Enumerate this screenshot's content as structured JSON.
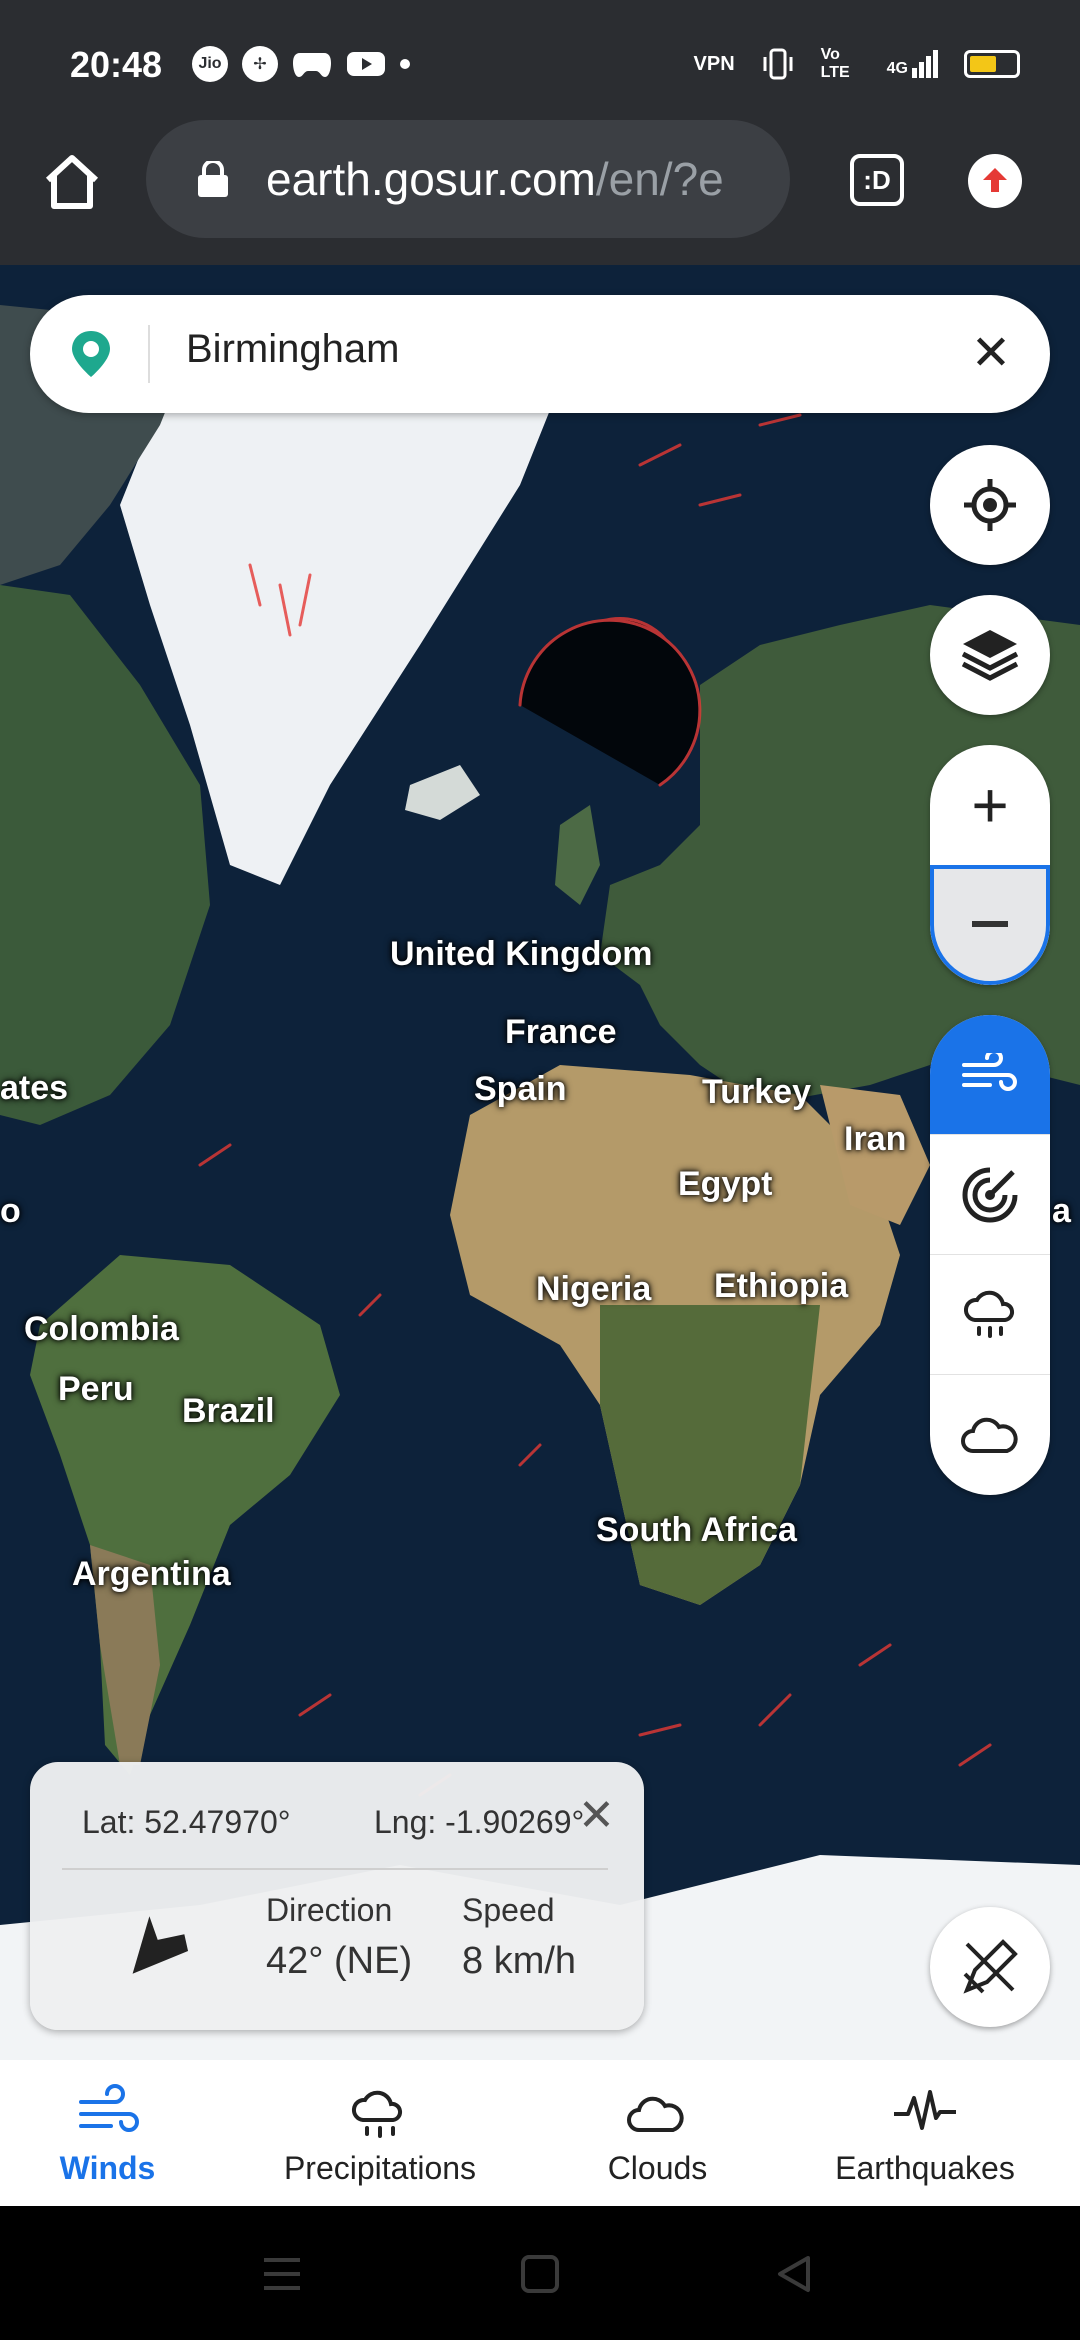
{
  "status_bar": {
    "time": "20:48",
    "left_icons": [
      "jio-icon",
      "pinwheel-icon",
      "gamepad-icon",
      "youtube-icon"
    ],
    "vpn_label": "VPN",
    "volte_label": "Vo LTE",
    "network_label": "4G",
    "battery_color": "#f3c617"
  },
  "browser": {
    "url_host": "earth.gosur.com",
    "url_path": "/en/?e",
    "tab_label": ":D"
  },
  "search": {
    "query": "Birmingham",
    "clear_label": "✕"
  },
  "map": {
    "country_labels": {
      "uk": "United Kingdom",
      "france": "France",
      "spain": "Spain",
      "turkey": "Turkey",
      "iran": "Iran",
      "egypt": "Egypt",
      "nigeria": "Nigeria",
      "ethiopia": "Ethiopia",
      "colombia": "Colombia",
      "peru": "Peru",
      "brazil": "Brazil",
      "argentina": "Argentina",
      "south_africa": "South Africa",
      "usa_partial": "ates",
      "edge_a": "a",
      "edge_o": "o"
    }
  },
  "controls": {
    "zoom_in_label": "+",
    "active_layer": "winds",
    "accent_color": "#1a73e8"
  },
  "info_card": {
    "lat": "Lat: 52.47970°",
    "lng": "Lng: -1.90269°",
    "close_label": "✕",
    "direction_label": "Direction",
    "direction_value": "42° (NE)",
    "speed_label": "Speed",
    "speed_value": "8 km/h"
  },
  "bottom_nav": {
    "items": [
      {
        "label": "Winds",
        "active": true
      },
      {
        "label": "Precipitations",
        "active": false
      },
      {
        "label": "Clouds",
        "active": false
      },
      {
        "label": "Earthquakes",
        "active": false
      }
    ]
  }
}
